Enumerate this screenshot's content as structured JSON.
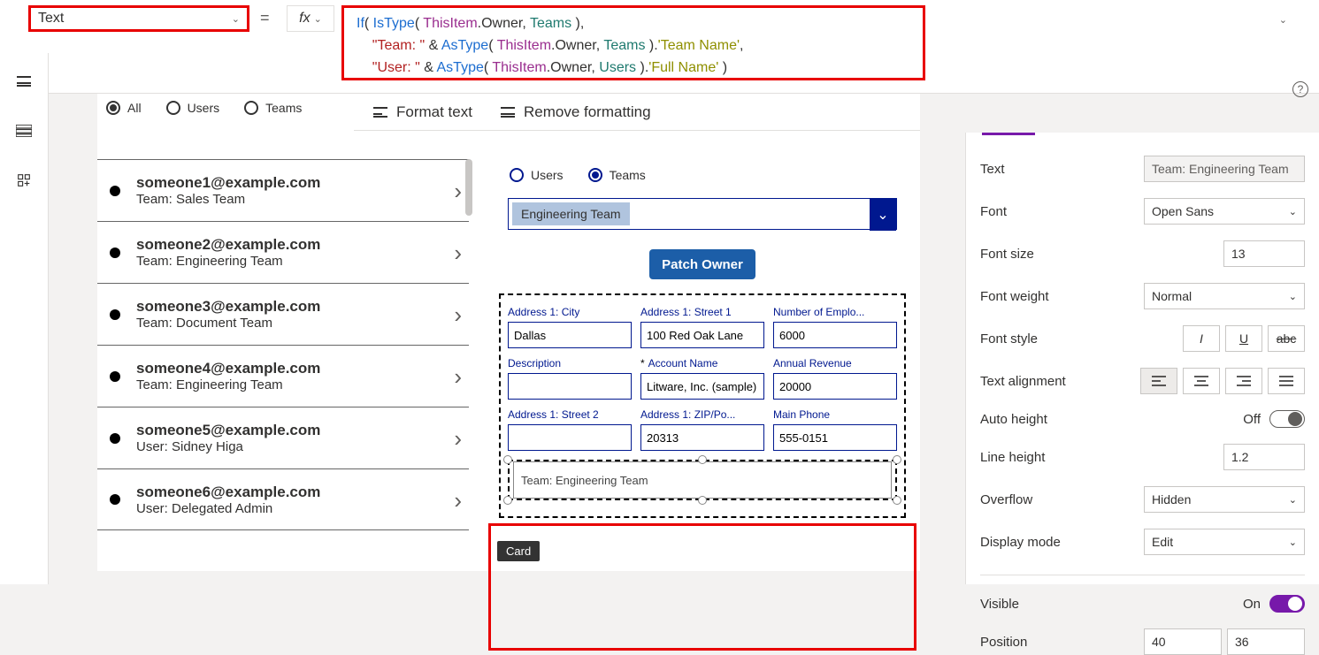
{
  "property_dropdown": {
    "value": "Text"
  },
  "formula": {
    "tokens": [
      {
        "t": "If",
        "c": "tok-fn"
      },
      {
        "t": "( "
      },
      {
        "t": "IsType",
        "c": "tok-fn"
      },
      {
        "t": "( "
      },
      {
        "t": "ThisItem",
        "c": "tok-id"
      },
      {
        "t": ".Owner, "
      },
      {
        "t": "Teams",
        "c": "tok-type"
      },
      {
        "t": " ),"
      },
      {
        "t": "\n    "
      },
      {
        "t": "\"Team: \"",
        "c": "tok-str"
      },
      {
        "t": " & "
      },
      {
        "t": "AsType",
        "c": "tok-fn"
      },
      {
        "t": "( "
      },
      {
        "t": "ThisItem",
        "c": "tok-id"
      },
      {
        "t": ".Owner, "
      },
      {
        "t": "Teams",
        "c": "tok-type"
      },
      {
        "t": " )."
      },
      {
        "t": "'Team Name'",
        "c": "tok-prop"
      },
      {
        "t": ","
      },
      {
        "t": "\n    "
      },
      {
        "t": "\"User: \"",
        "c": "tok-str"
      },
      {
        "t": " & "
      },
      {
        "t": "AsType",
        "c": "tok-fn"
      },
      {
        "t": "( "
      },
      {
        "t": "ThisItem",
        "c": "tok-id"
      },
      {
        "t": ".Owner, "
      },
      {
        "t": "Users",
        "c": "tok-type"
      },
      {
        "t": " )."
      },
      {
        "t": "'Full Name'",
        "c": "tok-prop"
      },
      {
        "t": " )"
      }
    ]
  },
  "formula_bar": {
    "format_text": "Format text",
    "remove_formatting": "Remove formatting"
  },
  "gallery": {
    "filters": {
      "all": "All",
      "users": "Users",
      "teams": "Teams",
      "selected": "all"
    },
    "items": [
      {
        "email": "someone1@example.com",
        "sub": "Team: Sales Team"
      },
      {
        "email": "someone2@example.com",
        "sub": "Team: Engineering Team"
      },
      {
        "email": "someone3@example.com",
        "sub": "Team: Document Team"
      },
      {
        "email": "someone4@example.com",
        "sub": "Team: Engineering Team"
      },
      {
        "email": "someone5@example.com",
        "sub": "User: Sidney Higa"
      },
      {
        "email": "someone6@example.com",
        "sub": "User: Delegated Admin"
      }
    ]
  },
  "detail": {
    "owner_radios": {
      "users": "Users",
      "teams": "Teams",
      "selected": "teams"
    },
    "combo_value": "Engineering Team",
    "patch_button": "Patch Owner",
    "tooltip": "Card",
    "fields": [
      {
        "label": "Address 1: City",
        "value": "Dallas"
      },
      {
        "label": "Address 1: Street 1",
        "value": "100 Red Oak Lane"
      },
      {
        "label": "Number of Emplo...",
        "value": "6000"
      },
      {
        "label": "Description",
        "value": ""
      },
      {
        "label": "Account Name",
        "value": "Litware, Inc. (sample)",
        "required": true
      },
      {
        "label": "Annual Revenue",
        "value": "20000"
      },
      {
        "label": "Address 1: Street 2",
        "value": ""
      },
      {
        "label": "Address 1: ZIP/Po...",
        "value": "20313"
      },
      {
        "label": "Main Phone",
        "value": "555-0151"
      }
    ],
    "selected_card_text": "Team: Engineering Team"
  },
  "props": {
    "text": {
      "label": "Text",
      "value": "Team: Engineering Team"
    },
    "font": {
      "label": "Font",
      "value": "Open Sans"
    },
    "font_size": {
      "label": "Font size",
      "value": "13"
    },
    "font_weight": {
      "label": "Font weight",
      "value": "Normal"
    },
    "font_style": {
      "label": "Font style"
    },
    "text_align": {
      "label": "Text alignment"
    },
    "auto_height": {
      "label": "Auto height",
      "state": "Off"
    },
    "line_height": {
      "label": "Line height",
      "value": "1.2"
    },
    "overflow": {
      "label": "Overflow",
      "value": "Hidden"
    },
    "display_mode": {
      "label": "Display mode",
      "value": "Edit"
    },
    "visible": {
      "label": "Visible",
      "state": "On"
    },
    "position": {
      "label": "Position",
      "x": "40",
      "y": "36"
    }
  }
}
